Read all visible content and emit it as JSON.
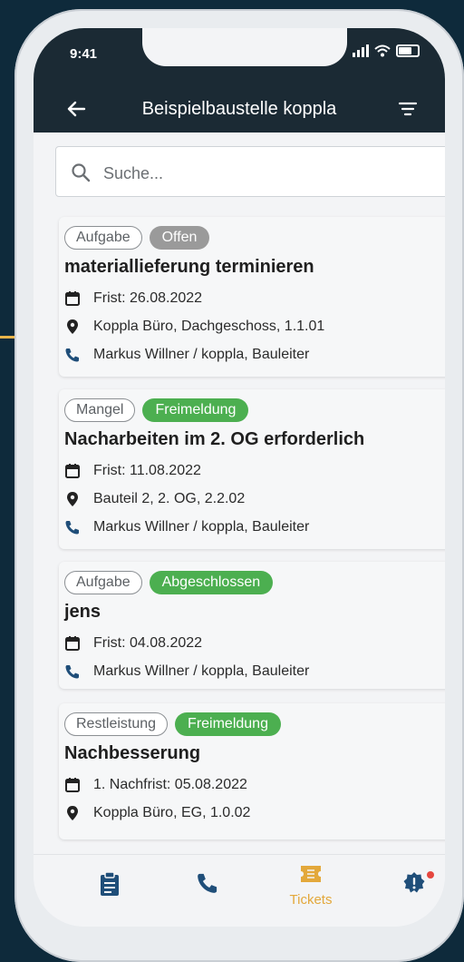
{
  "status": {
    "time": "9:41"
  },
  "header": {
    "title": "Beispielbaustelle koppla"
  },
  "search": {
    "placeholder": "Suche..."
  },
  "tickets": [
    {
      "type": "Aufgabe",
      "status": "Offen",
      "status_color": "#9a9a9a",
      "title": "materiallieferung terminieren",
      "deadline": "Frist: 26.08.2022",
      "location": "Koppla Büro, Dachgeschoss, 1.1.01",
      "contact": "Markus Willner / koppla, Bauleiter"
    },
    {
      "type": "Mangel",
      "status": "Freimeldung",
      "status_color": "#4caf50",
      "title": "Nacharbeiten im 2. OG erforderlich",
      "deadline": "Frist: 11.08.2022",
      "location": "Bauteil 2, 2. OG, 2.2.02",
      "contact": "Markus Willner / koppla, Bauleiter"
    },
    {
      "type": "Aufgabe",
      "status": "Abgeschlossen",
      "status_color": "#4caf50",
      "title": "jens",
      "deadline": "Frist: 04.08.2022",
      "contact": "Markus Willner / koppla, Bauleiter"
    },
    {
      "type": "Restleistung",
      "status": "Freimeldung",
      "status_color": "#4caf50",
      "title": "Nachbesserung",
      "deadline": "1. Nachfrist: 05.08.2022",
      "location": "Koppla Büro, EG, 1.0.02"
    }
  ],
  "bottom_nav": {
    "items": [
      {
        "icon": "clipboard-icon"
      },
      {
        "icon": "phone-icon"
      },
      {
        "icon": "ticket-icon",
        "label": "Tickets",
        "active": true
      },
      {
        "icon": "alert-badge-icon",
        "has_notification": true
      }
    ]
  },
  "colors": {
    "appbar": "#1b2a34",
    "accent": "#e3a83b",
    "nav_icon": "#1f4e79",
    "status_green": "#4caf50",
    "status_grey": "#9a9a9a"
  }
}
